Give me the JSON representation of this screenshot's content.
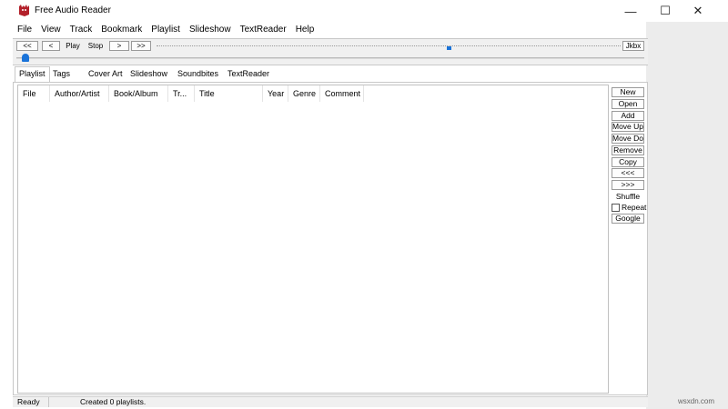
{
  "window": {
    "title": "Free Audio Reader"
  },
  "titlebar_buttons": {
    "minimize": "—",
    "maximize": "☐",
    "close": "✕"
  },
  "menu": [
    "File",
    "View",
    "Track",
    "Bookmark",
    "Playlist",
    "Slideshow",
    "TextReader",
    "Help"
  ],
  "transport": {
    "prev_track": "<<",
    "rewind": "<",
    "play": "Play",
    "stop": "Stop",
    "forward": ">",
    "next_track": ">>",
    "jukebox": "Jkbx"
  },
  "tabs": [
    "Playlist",
    "Tags",
    "Cover Art",
    "Slideshow",
    "Soundbites",
    "TextReader"
  ],
  "playlist_columns": [
    "File",
    "Author/Artist",
    "Book/Album",
    "Tr...",
    "Title",
    "Year",
    "Genre",
    "Comment"
  ],
  "side_buttons": {
    "new": "New",
    "open": "Open",
    "add": "Add",
    "move_up": "Move Up",
    "move_down": "Move Down",
    "remove": "Remove",
    "copy": "Copy",
    "prev": "<<<",
    "next": ">>>",
    "shuffle": "Shuffle",
    "repeat": "Repeat",
    "google": "Google"
  },
  "status": {
    "ready": "Ready",
    "message": "Created 0 playlists."
  },
  "watermark": "wsxdn.com",
  "colors": {
    "accent": "#1a73d9",
    "icon": "#b3202a"
  }
}
